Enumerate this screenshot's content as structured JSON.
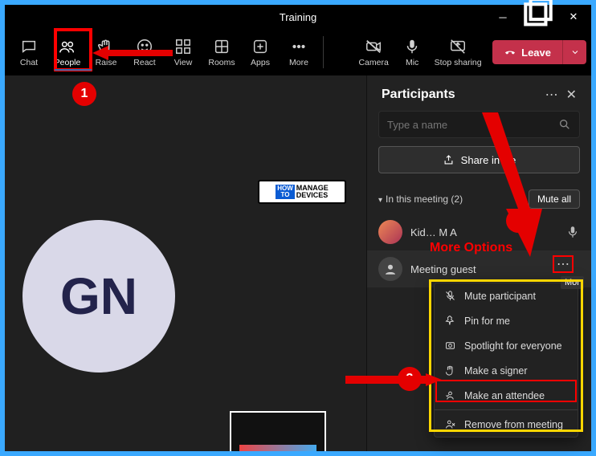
{
  "title": "Training",
  "toolbar": {
    "chat": "Chat",
    "people": "People",
    "raise": "Raise",
    "react": "React",
    "view": "View",
    "rooms": "Rooms",
    "apps": "Apps",
    "more": "More",
    "camera": "Camera",
    "mic": "Mic",
    "stop_sharing": "Stop sharing",
    "leave": "Leave"
  },
  "panel": {
    "title": "Participants",
    "search_placeholder": "Type a name",
    "share_invite": "Share invite",
    "in_meeting": "In this meeting (2)",
    "mute_all": "Mute all",
    "p1_name": "Kid…  M  A",
    "p2_name": "Meeting guest"
  },
  "menu": {
    "mute": "Mute participant",
    "pin": "Pin for me",
    "spotlight": "Spotlight for everyone",
    "signer": "Make a signer",
    "attendee": "Make an attendee",
    "remove": "Remove from meeting"
  },
  "annotations": {
    "num1": "1",
    "num2": "2",
    "num3": "3",
    "more_options": "More Options",
    "more_tooltip": "Mor"
  },
  "avatar_initials": "GN",
  "watermark": {
    "t1": "HOW",
    "t2": "TO",
    "t3": "MANAGE",
    "t4": "DEVICES"
  },
  "colors": {
    "red": "#e40000",
    "yellow": "#fdd600",
    "leave": "#c4314b"
  }
}
